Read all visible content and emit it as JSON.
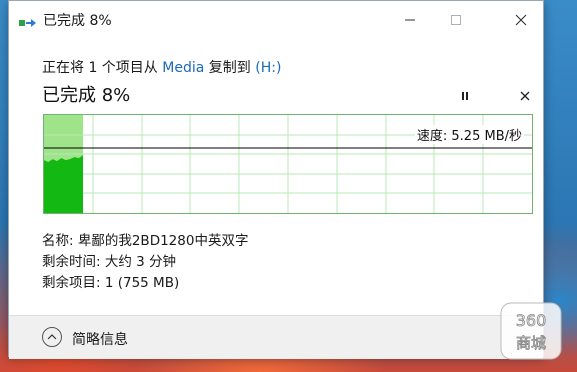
{
  "window": {
    "title": "已完成 8%",
    "minimize_label": "—",
    "maximize_label": "☐",
    "close_label": "✕"
  },
  "copy_status": {
    "prefix": "正在将 1 个项目从 ",
    "source": "Media",
    "middle": " 复制到 ",
    "destination": "(H:)"
  },
  "progress": {
    "heading": "已完成 8%",
    "percent": 8,
    "speed_text": "速度: 5.25 MB/秒"
  },
  "details": {
    "name": "名称: 卑鄙的我2BD1280中英双字",
    "time_remaining": "剩余时间: 大约 3 分钟",
    "items_remaining": "剩余项目: 1 (755 MB)"
  },
  "footer": {
    "toggle_label": "简略信息"
  },
  "watermark": {
    "line1": "360",
    "line2": "商城"
  },
  "colors": {
    "graph_fill": "#13b813",
    "graph_progress_bg": "#9fe38a",
    "graph_grid": "#b9e7b9",
    "link": "#1b6bb8"
  }
}
